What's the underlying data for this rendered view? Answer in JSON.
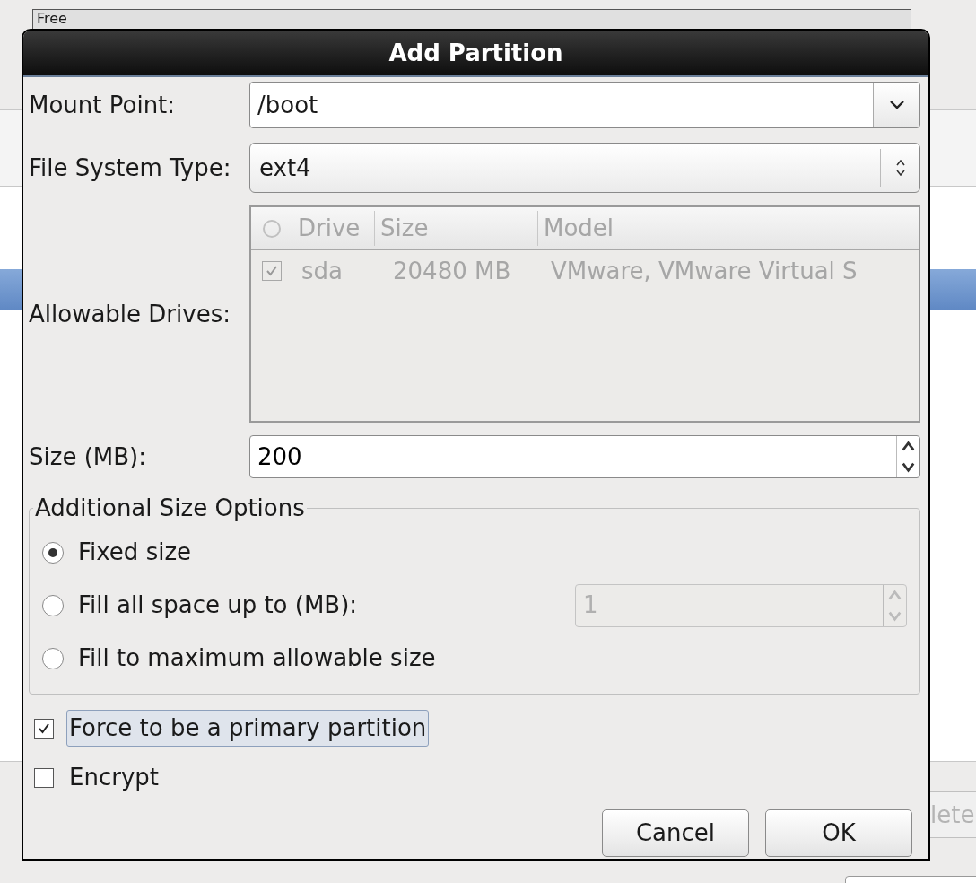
{
  "background": {
    "list_header": "Free",
    "button": "lete"
  },
  "dialog": {
    "title": "Add Partition",
    "mount_point": {
      "label": "Mount Point:",
      "value": "/boot"
    },
    "file_system_type": {
      "label": "File System Type:",
      "value": "ext4"
    },
    "allowable_drives": {
      "label": "Allowable Drives:",
      "disabled": true,
      "columns": [
        "Drive",
        "Size",
        "Model"
      ],
      "rows": [
        {
          "checked": true,
          "drive": "sda",
          "size": "20480 MB",
          "model": "VMware, VMware Virtual S"
        }
      ]
    },
    "size": {
      "label": "Size (MB):",
      "value": "200"
    },
    "size_options": {
      "title": "Additional Size Options",
      "options": [
        {
          "label": "Fixed size",
          "selected": true
        },
        {
          "label": "Fill all space up to (MB):",
          "selected": false,
          "field": {
            "value": "1",
            "disabled": true
          }
        },
        {
          "label": "Fill to maximum allowable size",
          "selected": false
        }
      ]
    },
    "checkboxes": [
      {
        "label": "Force to be a primary partition",
        "checked": true,
        "focused": true
      },
      {
        "label": "Encrypt",
        "checked": false,
        "focused": false
      }
    ],
    "buttons": [
      "Cancel",
      "OK"
    ]
  }
}
